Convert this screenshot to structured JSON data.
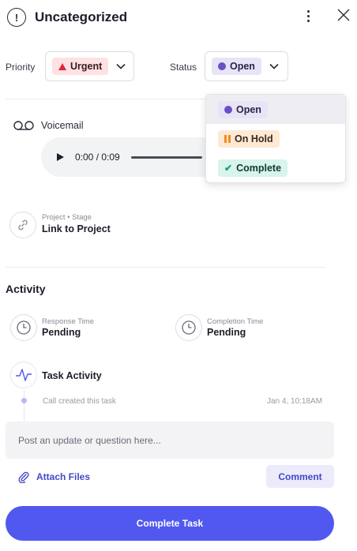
{
  "header": {
    "title": "Uncategorized",
    "icon": "exclamation-circle-icon",
    "icon_glyph": "!",
    "more_icon": "kebab-menu-icon",
    "close_icon": "close-icon"
  },
  "priority": {
    "label": "Priority",
    "value": "Urgent",
    "color": "#e0283a"
  },
  "status": {
    "label": "Status",
    "value": "Open",
    "color": "#6a4fc7",
    "menu": [
      {
        "label": "Open",
        "selected": true
      },
      {
        "label": "On Hold",
        "selected": false
      },
      {
        "label": "Complete",
        "selected": false
      }
    ]
  },
  "voicemail": {
    "label": "Voicemail",
    "time": "0:00 / 0:09"
  },
  "project": {
    "caption": "Project • Stage",
    "link_label": "Link to Project"
  },
  "activity": {
    "title": "Activity",
    "response_time": {
      "label": "Response Time",
      "value": "Pending"
    },
    "completion_time": {
      "label": "Completion Time",
      "value": "Pending"
    },
    "task_activity_label": "Task Activity",
    "entries": [
      {
        "text": "Call created this task",
        "time": "Jan 4, 10:18AM"
      }
    ]
  },
  "composer": {
    "placeholder": "Post an update or question here...",
    "attach_label": "Attach Files",
    "comment_label": "Comment"
  },
  "footer": {
    "complete_label": "Complete Task"
  },
  "colors": {
    "accent": "#5158f0",
    "urgent": "#e0283a",
    "open": "#6a4fc7",
    "on_hold": "#f08c1e",
    "complete": "#19a37a"
  }
}
